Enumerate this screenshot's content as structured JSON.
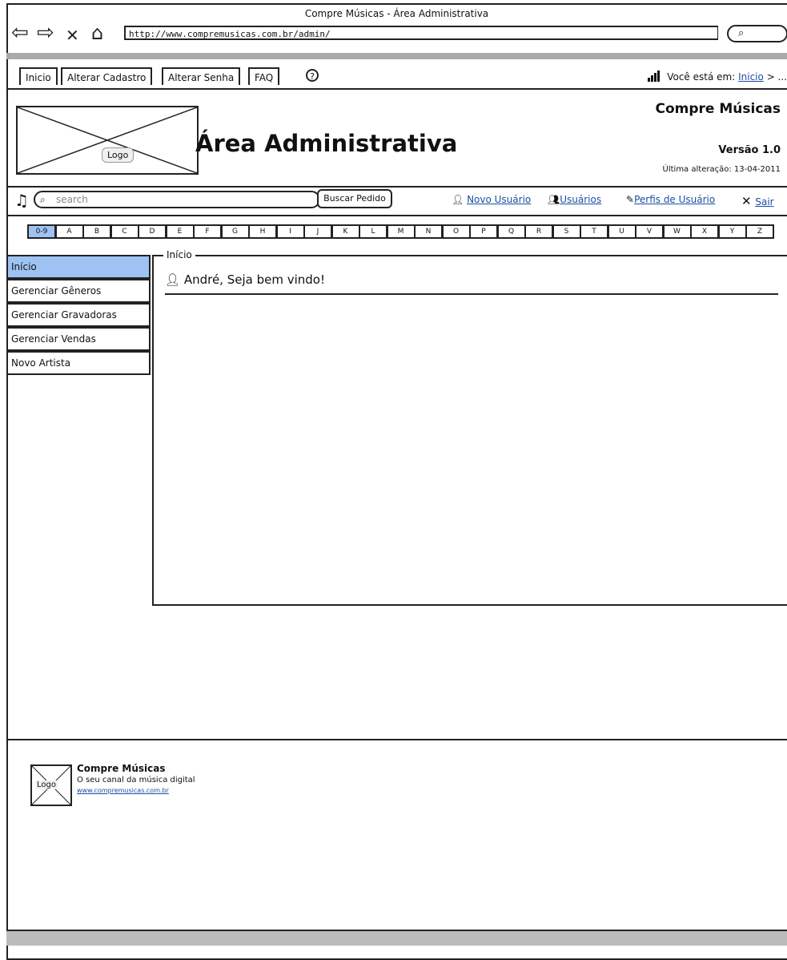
{
  "window": {
    "title": "Compre Músicas - Área Administrativa",
    "url": "http://www.compremusicas.com.br/admin/"
  },
  "top_tabs": [
    {
      "label": "Inicio"
    },
    {
      "label": "Alterar Cadastro"
    },
    {
      "label": "Alterar Senha"
    },
    {
      "label": "FAQ"
    }
  ],
  "breadcrumb": {
    "prefix": "Você está em:",
    "current": "Inicio",
    "suffix": "> ..."
  },
  "header": {
    "logo_label": "Logo",
    "title": "Área Administrativa",
    "brand": "Compre Músicas",
    "version": "Versão 1.0",
    "last_update": "Última alteração: 13-04-2011"
  },
  "toolbar": {
    "search_placeholder": "search",
    "order_button": "Buscar Pedido",
    "links": [
      {
        "label": "Novo Usuário",
        "icon": "user-icon"
      },
      {
        "label": "Usuários",
        "icon": "users-icon"
      },
      {
        "label": "Perfis de Usuário",
        "icon": "pencil-icon"
      },
      {
        "label": "Sair",
        "icon": "close-icon"
      }
    ]
  },
  "alphabet": [
    "0-9",
    "A",
    "B",
    "C",
    "D",
    "E",
    "F",
    "G",
    "H",
    "I",
    "J",
    "K",
    "L",
    "M",
    "N",
    "O",
    "P",
    "Q",
    "R",
    "S",
    "T",
    "U",
    "V",
    "W",
    "X",
    "Y",
    "Z"
  ],
  "alphabet_active": "0-9",
  "sidebar": [
    {
      "label": "Início",
      "active": true
    },
    {
      "label": "Gerenciar Gêneros",
      "active": false
    },
    {
      "label": "Gerenciar Gravadoras",
      "active": false
    },
    {
      "label": "Gerenciar Vendas",
      "active": false
    },
    {
      "label": "Novo Artista",
      "active": false
    }
  ],
  "content": {
    "legend": "Início",
    "welcome": "André, Seja bem vindo!"
  },
  "footer": {
    "logo_label": "Logo",
    "brand": "Compre Músicas",
    "tagline": "O seu canal da música digital",
    "link": "www.compremusicas.com.br"
  },
  "colors": {
    "active_fill": "#9ec3f3",
    "link": "#1a4ea3"
  }
}
